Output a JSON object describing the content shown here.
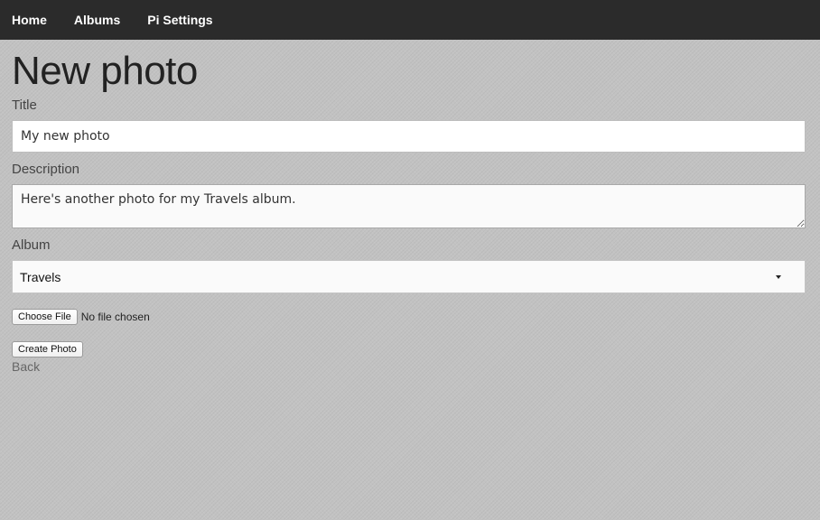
{
  "nav": {
    "items": [
      {
        "label": "Home"
      },
      {
        "label": "Albums"
      },
      {
        "label": "Pi Settings"
      }
    ]
  },
  "page": {
    "title": "New photo"
  },
  "form": {
    "title_label": "Title",
    "title_value": "My new photo",
    "description_label": "Description",
    "description_value": "Here's another photo for my Travels album.",
    "album_label": "Album",
    "album_selected": "Travels",
    "file_button_label": "Choose File",
    "file_status": "No file chosen",
    "submit_label": "Create Photo",
    "back_label": "Back"
  },
  "icons": {
    "album_dropdown": "caret-down-icon"
  },
  "colors": {
    "navbar_bg": "#2b2b2b",
    "page_bg": "#c2c2c2"
  }
}
